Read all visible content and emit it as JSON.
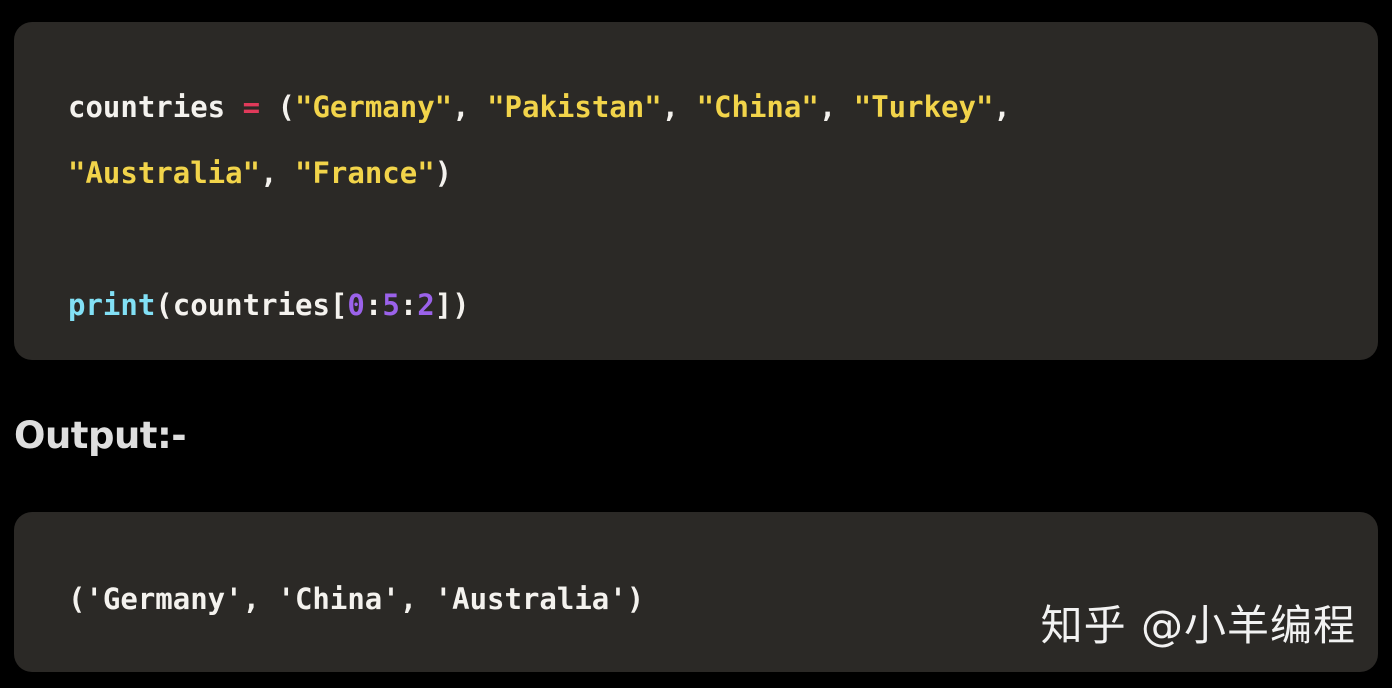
{
  "page": {
    "background_color": "#000000",
    "code_block_background": "#2b2926"
  },
  "colors": {
    "plain": "#f4f2ee",
    "string": "#f2d44a",
    "operator": "#e03a5a",
    "function": "#82e0f5",
    "number": "#9b62ea",
    "heading": "#dedede",
    "watermark": "#f2f2f2"
  },
  "source_block": {
    "language": "python",
    "full_text": "countries = (\"Germany\", \"Pakistan\", \"China\", \"Turkey\", \"Australia\", \"France\")\n\nprint(countries[0:5:2])",
    "line1": {
      "variable": "countries",
      "operator": "=",
      "open_paren": " (",
      "s1": "\"Germany\"",
      "c1": ", ",
      "s2": "\"Pakistan\"",
      "c2": ", ",
      "s3": "\"China\"",
      "c3": ", ",
      "s4": "\"Turkey\"",
      "c4": ","
    },
    "line2": {
      "s5": "\"Australia\"",
      "c5": ", ",
      "s6": "\"France\"",
      "close_paren": ")"
    },
    "line3": {
      "fn": "print",
      "open": "(countries[",
      "start": "0",
      "colon1": ":",
      "stop": "5",
      "colon2": ":",
      "step": "2",
      "close": "])"
    }
  },
  "output_heading": {
    "label": "Output:-"
  },
  "output_block": {
    "line1": "('Germany', 'China', 'Australia')"
  },
  "watermark": {
    "text": "知乎 @小羊编程"
  }
}
